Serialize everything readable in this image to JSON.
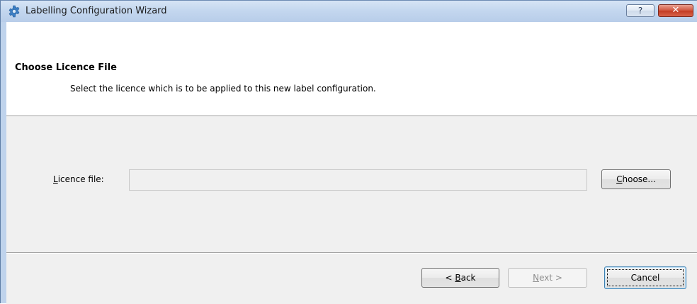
{
  "window": {
    "title": "Labelling Configuration Wizard",
    "help_label": "?",
    "close_label": "✕"
  },
  "header": {
    "title": "Choose Licence File",
    "subtitle": "Select the licence which is to be applied to this new label configuration."
  },
  "form": {
    "licence_label_mnemonic": "L",
    "licence_label_rest": "icence file:",
    "licence_value": "",
    "choose_mnemonic": "C",
    "choose_rest": "hoose..."
  },
  "footer": {
    "back_prefix": "< ",
    "back_mnemonic": "B",
    "back_rest": "ack",
    "next_mnemonic": "N",
    "next_rest": "ext >",
    "cancel_label": "Cancel"
  },
  "icons": {
    "app": "gear-icon",
    "help": "question-icon",
    "close": "close-icon"
  },
  "colors": {
    "titlebar": "#c4d7ef",
    "close_button": "#c23a22",
    "client_bg": "#f0f0f0",
    "header_bg": "#ffffff"
  }
}
